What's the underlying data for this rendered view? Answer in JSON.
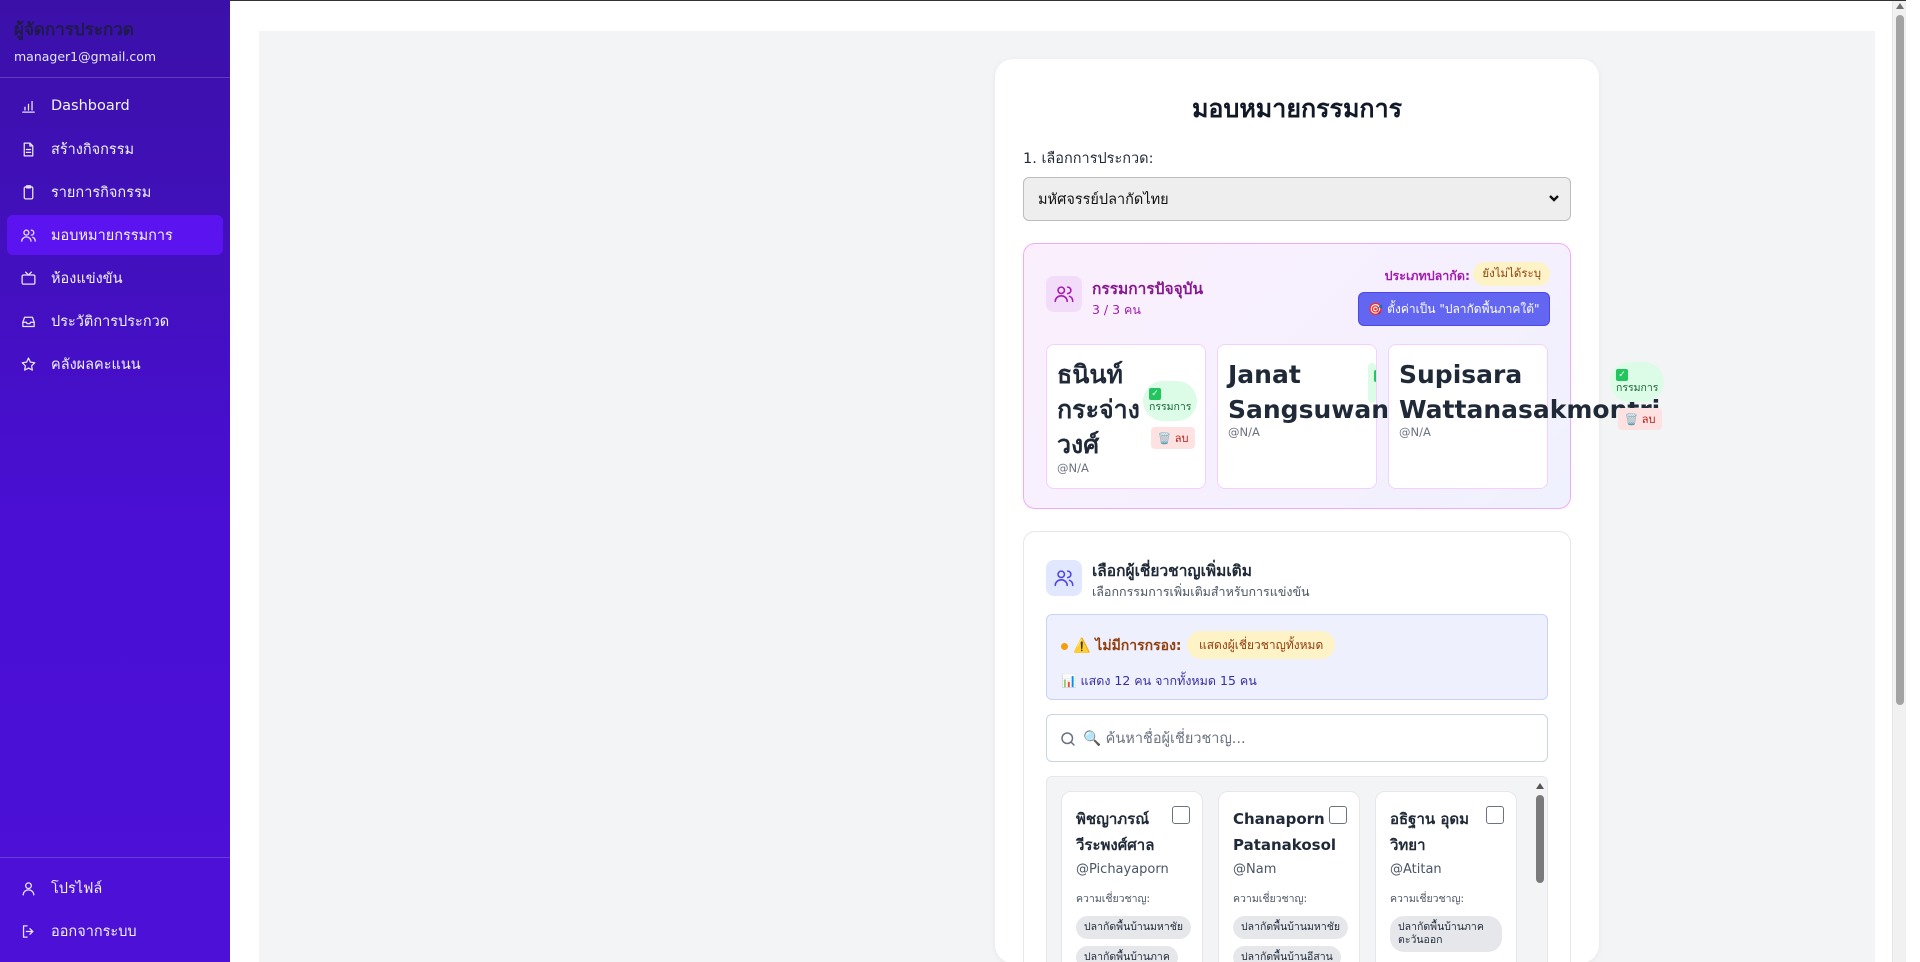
{
  "sidebar": {
    "title": "ผู้จัดการประกวด",
    "email": "manager1@gmail.com",
    "items": [
      {
        "label": "Dashboard",
        "icon": "bar-chart-icon"
      },
      {
        "label": "สร้างกิจกรรม",
        "icon": "document-icon"
      },
      {
        "label": "รายการกิจกรรม",
        "icon": "clipboard-icon"
      },
      {
        "label": "มอบหมายกรรมการ",
        "icon": "users-icon",
        "active": true
      },
      {
        "label": "ห้องแข่งขัน",
        "icon": "tv-icon"
      },
      {
        "label": "ประวัติการประกวด",
        "icon": "archive-icon"
      },
      {
        "label": "คลังผลคะแนน",
        "icon": "star-icon"
      }
    ],
    "footer": [
      {
        "label": "โปรไฟล์",
        "icon": "user-icon"
      },
      {
        "label": "ออกจากระบบ",
        "icon": "logout-icon"
      }
    ]
  },
  "page": {
    "title": "มอบหมายกรรมการ",
    "select_label": "1. เลือกการประกวด:",
    "select_value": "มหัศจรรย์ปลากัดไทย"
  },
  "current_judges": {
    "title": "กรรมการปัจจุบัน",
    "count": "3 / 3 คน",
    "fish_type_label": "ประเภทปลากัด:",
    "fish_type_value": "ยังไม่ได้ระบุ",
    "set_button": "🎯 ตั้งค่าเป็น \"ปลากัดพื้นภาคใต้\"",
    "role_label": "กรรมการ",
    "delete_label": "🗑️ ลบ",
    "judges": [
      {
        "name_lines": [
          "ธนินท์",
          "กระจ่าง",
          "วงศ์"
        ],
        "username": "@N/A"
      },
      {
        "name_lines": [
          "Janat",
          "Sangsuwan"
        ],
        "username": "@N/A"
      },
      {
        "name_lines": [
          "Supisara",
          "Wattanasakmontri"
        ],
        "username": "@N/A"
      }
    ]
  },
  "experts": {
    "title": "เลือกผู้เชี่ยวชาญเพิ่มเติม",
    "subtitle": "เลือกกรรมการเพิ่มเติมสำหรับการแข่งขัน",
    "no_filter": "⚠️ ไม่มีการกรอง:",
    "show_all": "แสดงผู้เชี่ยวชาญทั้งหมด",
    "count_line": "📊 แสดง 12 คน จากทั้งหมด 15 คน",
    "search_placeholder": "🔍 ค้นหาชื่อผู้เชี่ยวชาญ...",
    "expertise_label": "ความเชี่ยวชาญ:",
    "list": [
      {
        "name_lines": [
          "พิชญาภรณ์",
          "วีระพงศ์ศาล"
        ],
        "handle": "@Pichayaporn",
        "tags": [
          "ปลากัดพื้นบ้านมหาชัย",
          "ปลากัดพื้นบ้านภาค"
        ]
      },
      {
        "name_lines": [
          "Chanaporn",
          "Patanakosol"
        ],
        "handle": "@Nam",
        "tags": [
          "ปลากัดพื้นบ้านมหาชัย",
          "ปลากัดพื้นบ้านอีสาน"
        ]
      },
      {
        "name_lines": [
          "อธิฐาน อุดม",
          "วิทยา"
        ],
        "handle": "@Atitan",
        "tags": [
          "ปลากัดพื้นบ้านภาค\nตะวันออก"
        ]
      }
    ]
  }
}
